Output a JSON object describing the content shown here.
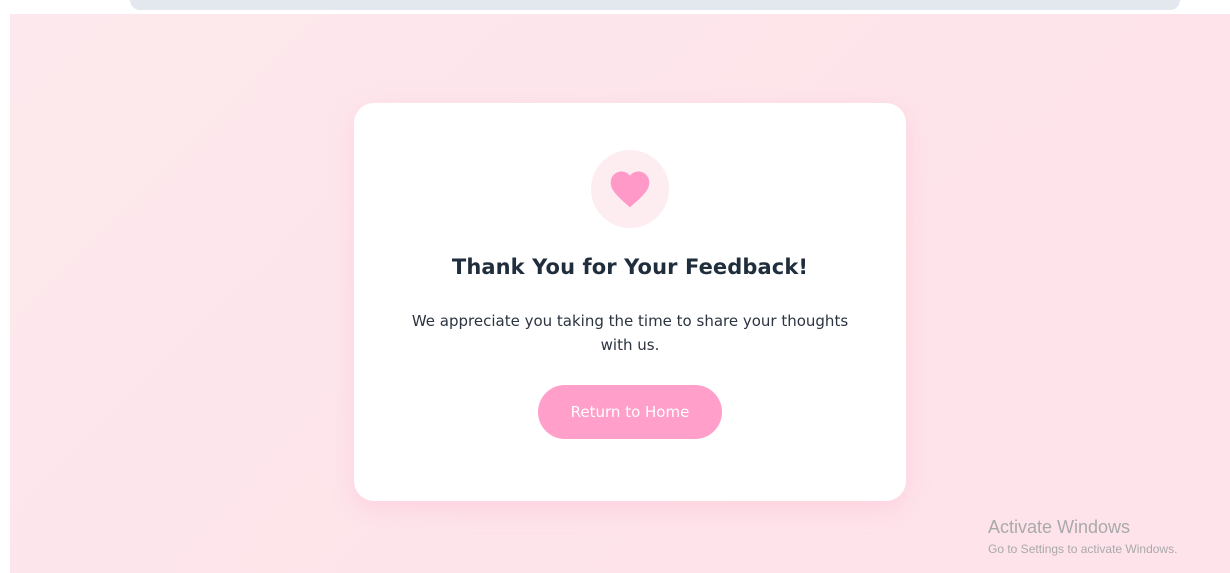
{
  "card": {
    "icon": "heart-icon",
    "title": "Thank You for Your Feedback!",
    "message": "We appreciate you taking the time to share your thoughts with us.",
    "button_label": "Return to Home"
  },
  "watermark": {
    "title": "Activate Windows",
    "subtitle": "Go to Settings to activate Windows."
  },
  "colors": {
    "accent": "#ff9fca",
    "heart": "#ff99c8",
    "heart_bg": "#fdecf0",
    "page_bg": "#fde7ec",
    "title_text": "#1f2d3d"
  }
}
